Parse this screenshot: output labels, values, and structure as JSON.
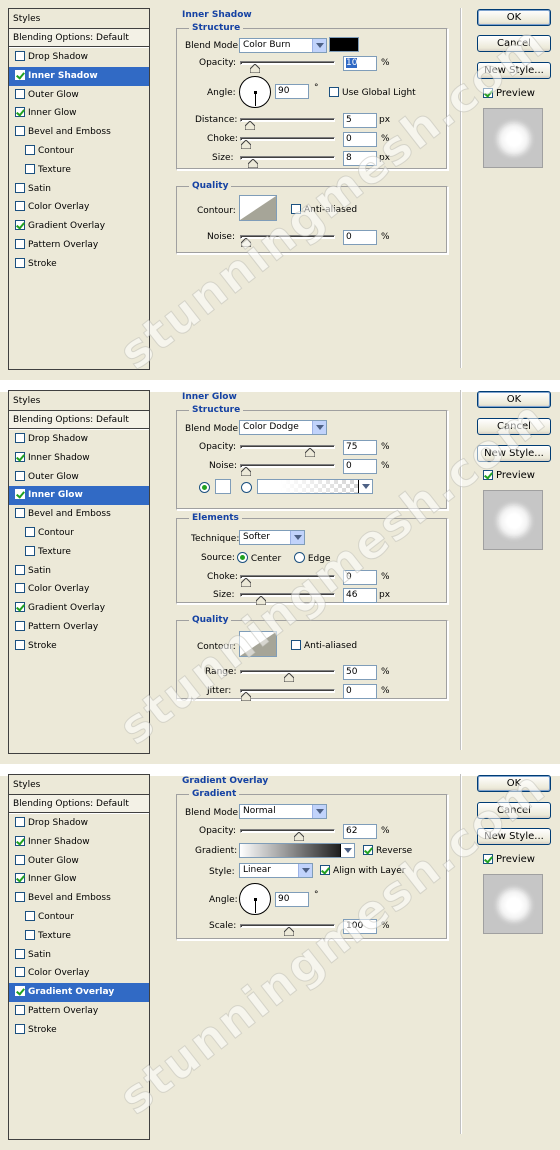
{
  "watermark": "stunningmesh.com",
  "buttons": {
    "ok": "OK",
    "cancel": "Cancel",
    "new_style": "New Style...",
    "preview": "Preview"
  },
  "styles_header": "Styles",
  "blending_options": "Blending Options: Default",
  "common_labels": {
    "blend_mode": "Blend Mode:",
    "opacity": "Opacity:",
    "angle": "Angle:",
    "noise": "Noise:",
    "choke": "Choke:",
    "size": "Size:",
    "contour": "Contour:",
    "anti_aliased": "Anti-aliased",
    "pct": "%",
    "px": "px",
    "deg": "°"
  },
  "panel1": {
    "styles": [
      {
        "label": "Drop Shadow",
        "checked": false,
        "selected": false,
        "sub": false
      },
      {
        "label": "Inner Shadow",
        "checked": true,
        "selected": true,
        "sub": false
      },
      {
        "label": "Outer Glow",
        "checked": false,
        "selected": false,
        "sub": false
      },
      {
        "label": "Inner Glow",
        "checked": true,
        "selected": false,
        "sub": false
      },
      {
        "label": "Bevel and Emboss",
        "checked": false,
        "selected": false,
        "sub": false
      },
      {
        "label": "Contour",
        "checked": false,
        "selected": false,
        "sub": true
      },
      {
        "label": "Texture",
        "checked": false,
        "selected": false,
        "sub": true
      },
      {
        "label": "Satin",
        "checked": false,
        "selected": false,
        "sub": false
      },
      {
        "label": "Color Overlay",
        "checked": false,
        "selected": false,
        "sub": false
      },
      {
        "label": "Gradient Overlay",
        "checked": true,
        "selected": false,
        "sub": false
      },
      {
        "label": "Pattern Overlay",
        "checked": false,
        "selected": false,
        "sub": false
      },
      {
        "label": "Stroke",
        "checked": false,
        "selected": false,
        "sub": false
      }
    ],
    "title": "Inner Shadow",
    "structure": "Structure",
    "quality": "Quality",
    "blend_mode": "Color Burn",
    "opacity": "10",
    "angle": "90",
    "use_global_light": "Use Global Light",
    "distance_label": "Distance:",
    "distance": "5",
    "choke": "0",
    "size": "8",
    "noise": "0",
    "levels": {
      "opacity": 0.1,
      "distance": 0.05,
      "choke": 0,
      "size": 0.08,
      "noise": 0
    }
  },
  "panel2": {
    "styles": [
      {
        "label": "Drop Shadow",
        "checked": false,
        "selected": false,
        "sub": false
      },
      {
        "label": "Inner Shadow",
        "checked": true,
        "selected": false,
        "sub": false
      },
      {
        "label": "Outer Glow",
        "checked": false,
        "selected": false,
        "sub": false
      },
      {
        "label": "Inner Glow",
        "checked": true,
        "selected": true,
        "sub": false
      },
      {
        "label": "Bevel and Emboss",
        "checked": false,
        "selected": false,
        "sub": false
      },
      {
        "label": "Contour",
        "checked": false,
        "selected": false,
        "sub": true
      },
      {
        "label": "Texture",
        "checked": false,
        "selected": false,
        "sub": true
      },
      {
        "label": "Satin",
        "checked": false,
        "selected": false,
        "sub": false
      },
      {
        "label": "Color Overlay",
        "checked": false,
        "selected": false,
        "sub": false
      },
      {
        "label": "Gradient Overlay",
        "checked": true,
        "selected": false,
        "sub": false
      },
      {
        "label": "Pattern Overlay",
        "checked": false,
        "selected": false,
        "sub": false
      },
      {
        "label": "Stroke",
        "checked": false,
        "selected": false,
        "sub": false
      }
    ],
    "title": "Inner Glow",
    "structure": "Structure",
    "elements": "Elements",
    "quality": "Quality",
    "blend_mode": "Color Dodge",
    "opacity": "75",
    "noise": "0",
    "technique_label": "Technique:",
    "technique": "Softer",
    "source_label": "Source:",
    "source_center": "Center",
    "source_edge": "Edge",
    "choke": "0",
    "size": "46",
    "range_label": "Range:",
    "range": "50",
    "jitter_label": "Jitter:",
    "jitter": "0",
    "levels": {
      "opacity": 0.75,
      "noise": 0,
      "choke": 0,
      "size": 0.18,
      "range": 0.5,
      "jitter": 0
    }
  },
  "panel3": {
    "styles": [
      {
        "label": "Drop Shadow",
        "checked": false,
        "selected": false,
        "sub": false
      },
      {
        "label": "Inner Shadow",
        "checked": true,
        "selected": false,
        "sub": false
      },
      {
        "label": "Outer Glow",
        "checked": false,
        "selected": false,
        "sub": false
      },
      {
        "label": "Inner Glow",
        "checked": true,
        "selected": false,
        "sub": false
      },
      {
        "label": "Bevel and Emboss",
        "checked": false,
        "selected": false,
        "sub": false
      },
      {
        "label": "Contour",
        "checked": false,
        "selected": false,
        "sub": true
      },
      {
        "label": "Texture",
        "checked": false,
        "selected": false,
        "sub": true
      },
      {
        "label": "Satin",
        "checked": false,
        "selected": false,
        "sub": false
      },
      {
        "label": "Color Overlay",
        "checked": false,
        "selected": false,
        "sub": false
      },
      {
        "label": "Gradient Overlay",
        "checked": true,
        "selected": true,
        "sub": false
      },
      {
        "label": "Pattern Overlay",
        "checked": false,
        "selected": false,
        "sub": false
      },
      {
        "label": "Stroke",
        "checked": false,
        "selected": false,
        "sub": false
      }
    ],
    "title": "Gradient Overlay",
    "gradient_group": "Gradient",
    "blend_mode": "Normal",
    "opacity": "62",
    "gradient_label": "Gradient:",
    "reverse": "Reverse",
    "style_label": "Style:",
    "style": "Linear",
    "align_with_layer": "Align with Layer",
    "angle": "90",
    "scale_label": "Scale:",
    "scale": "100",
    "levels": {
      "opacity": 0.62,
      "scale": 0.5
    }
  }
}
